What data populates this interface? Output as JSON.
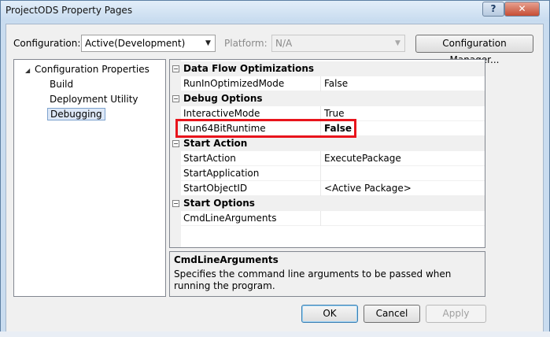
{
  "window": {
    "title": "ProjectODS Property Pages",
    "help_glyph": "?",
    "close_glyph": "✕"
  },
  "toolbar": {
    "configuration_label": "Configuration:",
    "configuration_value": "Active(Development)",
    "platform_label": "Platform:",
    "platform_value": "N/A",
    "config_manager_label": "Configuration Manager..."
  },
  "tree": {
    "root": "Configuration Properties",
    "items": [
      "Build",
      "Deployment Utility",
      "Debugging"
    ],
    "selected": "Debugging"
  },
  "grid": {
    "categories": [
      {
        "name": "Data Flow Optimizations",
        "props": [
          {
            "name": "RunInOptimizedMode",
            "value": "False"
          }
        ]
      },
      {
        "name": "Debug Options",
        "props": [
          {
            "name": "InteractiveMode",
            "value": "True"
          },
          {
            "name": "Run64BitRuntime",
            "value": "False"
          }
        ]
      },
      {
        "name": "Start Action",
        "props": [
          {
            "name": "StartAction",
            "value": "ExecutePackage"
          },
          {
            "name": "StartApplication",
            "value": ""
          },
          {
            "name": "StartObjectID",
            "value": "<Active Package>"
          }
        ]
      },
      {
        "name": "Start Options",
        "props": [
          {
            "name": "CmdLineArguments",
            "value": ""
          }
        ]
      }
    ]
  },
  "description": {
    "title": "CmdLineArguments",
    "text": "Specifies the command line arguments to be passed when running the program."
  },
  "buttons": {
    "ok": "OK",
    "cancel": "Cancel",
    "apply": "Apply"
  },
  "colors": {
    "highlight": "#e8141c",
    "title_bar": "#c9dcef"
  }
}
